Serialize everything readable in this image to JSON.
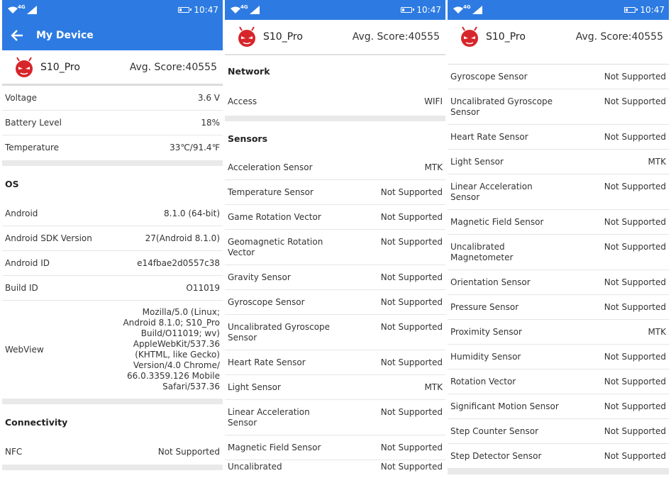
{
  "status": {
    "network": "4G",
    "time": "10:47"
  },
  "appbar": {
    "title": "My Device"
  },
  "device": {
    "name": "S10_Pro",
    "avg_score": "Avg. Score:40555"
  },
  "panel1": {
    "battery_rows": [
      {
        "label": "Voltage",
        "value": "3.6 V"
      },
      {
        "label": "Battery Level",
        "value": "18%"
      },
      {
        "label": "Temperature",
        "value": "33℃/91.4℉"
      }
    ],
    "os_title": "OS",
    "os_rows": [
      {
        "label": "Android",
        "value": "8.1.0 (64-bit)"
      },
      {
        "label": "Android SDK Version",
        "value": "27(Android 8.1.0)"
      },
      {
        "label": "Android ID",
        "value": "e14fbae2d0557c38"
      },
      {
        "label": "Build ID",
        "value": "O11019"
      }
    ],
    "webview": {
      "label": "WebView",
      "value": "Mozilla/5.0 (Linux; Android 8.1.0; S10_Pro Build/O11019; wv) AppleWebKit/537.36 (KHTML, like Gecko) Version/4.0 Chrome/ 66.0.3359.126 Mobile Safari/537.36"
    },
    "connectivity_title": "Connectivity",
    "connectivity_rows": [
      {
        "label": "NFC",
        "value": "Not Supported"
      }
    ]
  },
  "panel2": {
    "network_title": "Network",
    "network_rows": [
      {
        "label": "Access",
        "value": "WIFI"
      }
    ],
    "sensors_title": "Sensors",
    "sensor_rows": [
      {
        "label": "Acceleration Sensor",
        "value": "MTK",
        "lines": 1
      },
      {
        "label": "Temperature Sensor",
        "value": "Not Supported",
        "lines": 1
      },
      {
        "label": "Game Rotation Vector",
        "value": "Not Supported",
        "lines": 1
      },
      {
        "label": "Geomagnetic Rotation Vector",
        "value": "Not Supported",
        "lines": 2
      },
      {
        "label": "Gravity Sensor",
        "value": "Not Supported",
        "lines": 1
      },
      {
        "label": "Gyroscope Sensor",
        "value": "Not Supported",
        "lines": 1
      },
      {
        "label": "Uncalibrated Gyroscope Sensor",
        "value": "Not Supported",
        "lines": 2
      },
      {
        "label": "Heart Rate Sensor",
        "value": "Not Supported",
        "lines": 1
      },
      {
        "label": "Light Sensor",
        "value": "MTK",
        "lines": 1
      },
      {
        "label": "Linear Acceleration Sensor",
        "value": "Not Supported",
        "lines": 2
      },
      {
        "label": "Magnetic Field Sensor",
        "value": "Not Supported",
        "lines": 1
      }
    ]
  },
  "panel3": {
    "sensor_rows": [
      {
        "label": "Gyroscope Sensor",
        "value": "Not Supported",
        "lines": 1
      },
      {
        "label": "Uncalibrated Gyroscope Sensor",
        "value": "Not Supported",
        "lines": 2
      },
      {
        "label": "Heart Rate Sensor",
        "value": "Not Supported",
        "lines": 1
      },
      {
        "label": "Light Sensor",
        "value": "MTK",
        "lines": 1
      },
      {
        "label": "Linear Acceleration Sensor",
        "value": "Not Supported",
        "lines": 2
      },
      {
        "label": "Magnetic Field Sensor",
        "value": "Not Supported",
        "lines": 1
      },
      {
        "label": "Uncalibrated Magnetometer",
        "value": "Not Supported",
        "lines": 2
      },
      {
        "label": "Orientation Sensor",
        "value": "Not Supported",
        "lines": 1
      },
      {
        "label": "Pressure Sensor",
        "value": "Not Supported",
        "lines": 1
      },
      {
        "label": "Proximity Sensor",
        "value": "MTK",
        "lines": 1
      },
      {
        "label": "Humidity Sensor",
        "value": "Not Supported",
        "lines": 1
      },
      {
        "label": "Rotation Vector",
        "value": "Not Supported",
        "lines": 1
      },
      {
        "label": "Significant Motion Sensor",
        "value": "Not Supported",
        "lines": 1
      },
      {
        "label": "Step Counter Sensor",
        "value": "Not Supported",
        "lines": 1
      },
      {
        "label": "Step Detector Sensor",
        "value": "Not Supported",
        "lines": 1
      }
    ]
  },
  "icons": {
    "wifi": "wifi-icon",
    "cell": "cell-signal-icon",
    "battery": "battery-icon",
    "back": "back-arrow-icon",
    "logo": "antutu-logo-icon"
  },
  "colors": {
    "accent": "#2d7be2",
    "logo_red": "#d7262b",
    "divider": "#e9e9e9"
  }
}
